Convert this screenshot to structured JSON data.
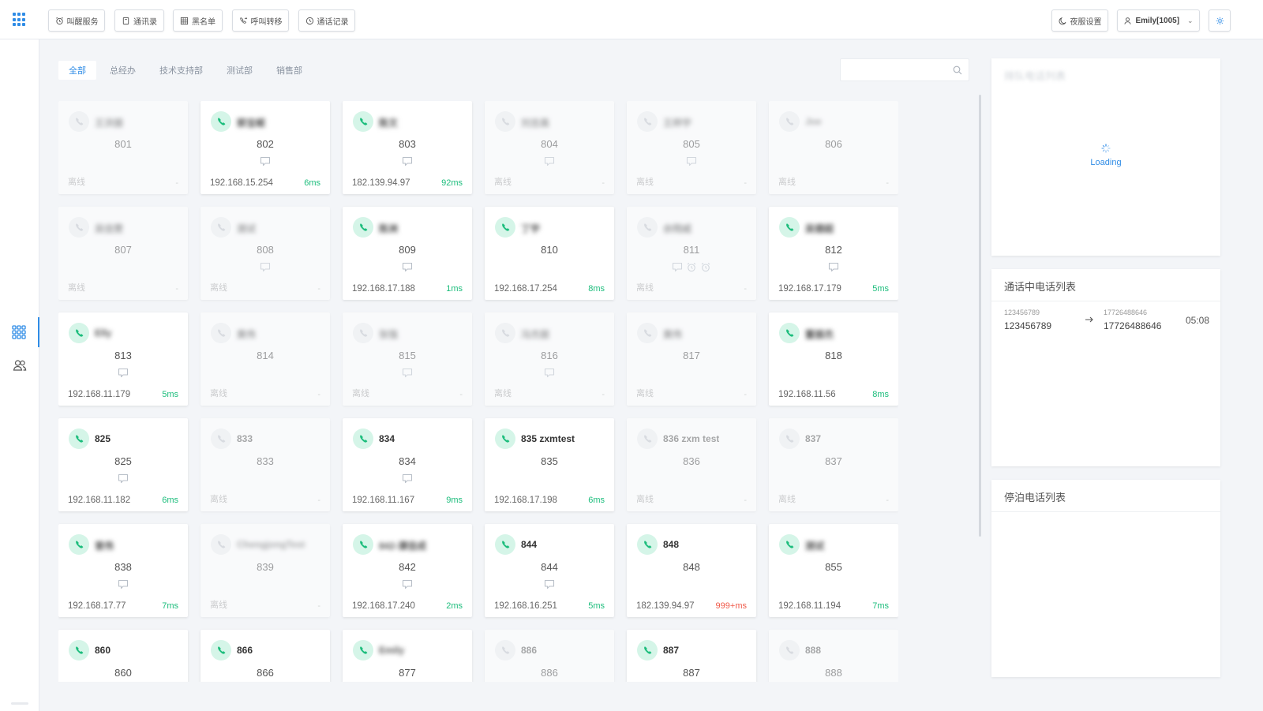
{
  "toolbar": {
    "buttons": [
      {
        "label": "叫醒服务",
        "icon": "alarm-clock-icon"
      },
      {
        "label": "通讯录",
        "icon": "contacts-book-icon"
      },
      {
        "label": "黑名单",
        "icon": "blacklist-icon"
      },
      {
        "label": "呼叫转移",
        "icon": "call-forward-icon"
      },
      {
        "label": "通话记录",
        "icon": "call-history-icon"
      }
    ],
    "night_mode": {
      "label": "夜服设置",
      "icon": "moon-icon"
    },
    "user": {
      "label": "Emily[1005]",
      "icon": "user-icon"
    },
    "settings_icon": "settings-icon"
  },
  "sidebar": {
    "items": [
      {
        "icon": "grid-apps-icon",
        "active": true
      },
      {
        "icon": "users-icon",
        "active": false
      }
    ]
  },
  "tabs": [
    "全部",
    "总经办",
    "技术支持部",
    "测试部",
    "销售部"
  ],
  "active_tab": "全部",
  "search": {
    "placeholder": ""
  },
  "extensions": [
    {
      "name": "王洪振",
      "name_blurred": true,
      "ext": "801",
      "online": false,
      "icons": [],
      "ip": "离线",
      "latency": "-"
    },
    {
      "name": "郭宝岷",
      "name_blurred": true,
      "ext": "802",
      "online": true,
      "icons": [
        "message"
      ],
      "ip": "192.168.15.254",
      "latency": "6ms"
    },
    {
      "name": "陈文",
      "name_blurred": true,
      "ext": "803",
      "online": true,
      "icons": [
        "message"
      ],
      "ip": "182.139.94.97",
      "latency": "92ms"
    },
    {
      "name": "刘吉高",
      "name_blurred": true,
      "ext": "804",
      "online": false,
      "icons": [
        "message"
      ],
      "ip": "离线",
      "latency": "-"
    },
    {
      "name": "王梓宇",
      "name_blurred": true,
      "ext": "805",
      "online": false,
      "icons": [
        "message"
      ],
      "ip": "离线",
      "latency": "-"
    },
    {
      "name": "Joe",
      "name_blurred": true,
      "ext": "806",
      "online": false,
      "icons": [],
      "ip": "离线",
      "latency": "-"
    },
    {
      "name": "吴佳雯",
      "name_blurred": true,
      "ext": "807",
      "online": false,
      "icons": [],
      "ip": "离线",
      "latency": "-"
    },
    {
      "name": "测试",
      "name_blurred": true,
      "ext": "808",
      "online": false,
      "icons": [
        "message"
      ],
      "ip": "离线",
      "latency": "-"
    },
    {
      "name": "陈洲",
      "name_blurred": true,
      "ext": "809",
      "online": true,
      "icons": [
        "message"
      ],
      "ip": "192.168.17.188",
      "latency": "1ms"
    },
    {
      "name": "丁宇",
      "name_blurred": true,
      "ext": "810",
      "online": true,
      "icons": [],
      "ip": "192.168.17.254",
      "latency": "8ms"
    },
    {
      "name": "余翔威",
      "name_blurred": true,
      "ext": "811",
      "online": false,
      "icons": [
        "message",
        "alarm",
        "alarm"
      ],
      "ip": "离线",
      "latency": "-"
    },
    {
      "name": "吴德超",
      "name_blurred": true,
      "ext": "812",
      "online": true,
      "icons": [
        "message"
      ],
      "ip": "192.168.17.179",
      "latency": "5ms"
    },
    {
      "name": "Elly",
      "name_blurred": true,
      "ext": "813",
      "online": true,
      "icons": [
        "message"
      ],
      "ip": "192.168.11.179",
      "latency": "5ms"
    },
    {
      "name": "黄伟",
      "name_blurred": true,
      "ext": "814",
      "online": false,
      "icons": [],
      "ip": "离线",
      "latency": "-"
    },
    {
      "name": "张强",
      "name_blurred": true,
      "ext": "815",
      "online": false,
      "icons": [
        "message"
      ],
      "ip": "离线",
      "latency": "-"
    },
    {
      "name": "冯杰丽",
      "name_blurred": true,
      "ext": "816",
      "online": false,
      "icons": [
        "message"
      ],
      "ip": "离线",
      "latency": "-"
    },
    {
      "name": "黄伟",
      "name_blurred": true,
      "ext": "817",
      "online": false,
      "icons": [],
      "ip": "离线",
      "latency": "-"
    },
    {
      "name": "董振杰",
      "name_blurred": true,
      "ext": "818",
      "online": true,
      "icons": [],
      "ip": "192.168.11.56",
      "latency": "8ms"
    },
    {
      "name": "825",
      "name_blurred": false,
      "ext": "825",
      "online": true,
      "icons": [
        "message"
      ],
      "ip": "192.168.11.182",
      "latency": "6ms"
    },
    {
      "name": "833",
      "name_blurred": false,
      "ext": "833",
      "online": false,
      "icons": [],
      "ip": "离线",
      "latency": "-"
    },
    {
      "name": "834",
      "name_blurred": false,
      "ext": "834",
      "online": true,
      "icons": [
        "message"
      ],
      "ip": "192.168.11.167",
      "latency": "9ms"
    },
    {
      "name": "835 zxmtest",
      "name_blurred": false,
      "ext": "835",
      "online": true,
      "icons": [],
      "ip": "192.168.17.198",
      "latency": "6ms"
    },
    {
      "name": "836 zxm test",
      "name_blurred": false,
      "ext": "836",
      "online": false,
      "icons": [],
      "ip": "离线",
      "latency": "-"
    },
    {
      "name": "837",
      "name_blurred": false,
      "ext": "837",
      "online": false,
      "icons": [],
      "ip": "离线",
      "latency": "-"
    },
    {
      "name": "曾伟",
      "name_blurred": true,
      "ext": "838",
      "online": true,
      "icons": [
        "message"
      ],
      "ip": "192.168.17.77",
      "latency": "7ms"
    },
    {
      "name": "ChengjongTest",
      "name_blurred": true,
      "ext": "839",
      "online": false,
      "icons": [],
      "ip": "离线",
      "latency": "-"
    },
    {
      "name": "842-谭佳成",
      "name_blurred": true,
      "ext": "842",
      "online": true,
      "icons": [
        "message"
      ],
      "ip": "192.168.17.240",
      "latency": "2ms"
    },
    {
      "name": "844",
      "name_blurred": false,
      "ext": "844",
      "online": true,
      "icons": [
        "message"
      ],
      "ip": "192.168.16.251",
      "latency": "5ms"
    },
    {
      "name": "848",
      "name_blurred": false,
      "ext": "848",
      "online": true,
      "icons": [],
      "ip": "182.139.94.97",
      "latency": "999+ms",
      "warn": true
    },
    {
      "name": "测试",
      "name_blurred": true,
      "ext": "855",
      "online": true,
      "icons": [],
      "ip": "192.168.11.194",
      "latency": "7ms"
    },
    {
      "name": "860",
      "name_blurred": false,
      "ext": "860",
      "online": true,
      "icons": [],
      "ip": "",
      "latency": ""
    },
    {
      "name": "866",
      "name_blurred": false,
      "ext": "866",
      "online": true,
      "icons": [],
      "ip": "",
      "latency": ""
    },
    {
      "name": "Emily",
      "name_blurred": true,
      "ext": "877",
      "online": true,
      "icons": [],
      "ip": "",
      "latency": ""
    },
    {
      "name": "886",
      "name_blurred": false,
      "ext": "886",
      "online": false,
      "icons": [],
      "ip": "",
      "latency": ""
    },
    {
      "name": "887",
      "name_blurred": false,
      "ext": "887",
      "online": true,
      "icons": [],
      "ip": "",
      "latency": ""
    },
    {
      "name": "888",
      "name_blurred": false,
      "ext": "888",
      "online": false,
      "icons": [],
      "ip": "",
      "latency": ""
    }
  ],
  "queue_panel": {
    "title": "排队电话列表",
    "loading_text": "Loading"
  },
  "active_calls_panel": {
    "title": "通话中电话列表",
    "calls": [
      {
        "caller_small": "123456789",
        "caller": "123456789",
        "callee_small": "17726488646",
        "callee": "17726488646",
        "duration": "05:08"
      }
    ]
  },
  "parked_panel": {
    "title": "停泊电话列表"
  },
  "colors": {
    "accent": "#2f8ce6",
    "online": "#1cbd7c",
    "warn": "#f05a4a"
  }
}
